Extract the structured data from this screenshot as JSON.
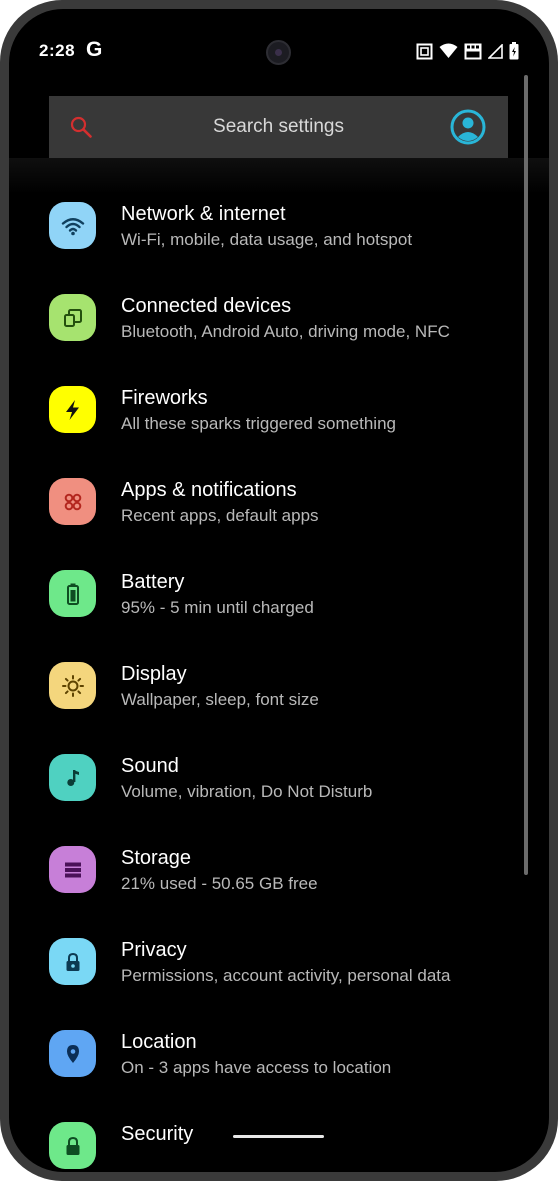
{
  "status_bar": {
    "time": "2:28",
    "g_label": "G",
    "icons": [
      "nfc-icon",
      "wifi-icon",
      "volte-icon",
      "signal-icon",
      "battery-icon"
    ]
  },
  "search": {
    "placeholder": "Search settings"
  },
  "colors": {
    "search_icon": "#d32f2f",
    "account_icon": "#29b6d8"
  },
  "items": [
    {
      "title": "Network & internet",
      "sub": "Wi-Fi, mobile, data usage, and hotspot",
      "icon": "wifi-icon",
      "color": "#90d4f7"
    },
    {
      "title": "Connected devices",
      "sub": "Bluetooth, Android Auto, driving mode, NFC",
      "icon": "devices-icon",
      "color": "#a6e36f"
    },
    {
      "title": "Fireworks",
      "sub": "All these sparks triggered something",
      "icon": "lightning-icon",
      "color": "#ffff00"
    },
    {
      "title": "Apps & notifications",
      "sub": "Recent apps, default apps",
      "icon": "apps-icon",
      "color": "#f08f80"
    },
    {
      "title": "Battery",
      "sub": "95% - 5 min until charged",
      "icon": "battery-icon",
      "color": "#6ee88a"
    },
    {
      "title": "Display",
      "sub": "Wallpaper, sleep, font size",
      "icon": "brightness-icon",
      "color": "#f4d67d"
    },
    {
      "title": "Sound",
      "sub": "Volume, vibration, Do Not Disturb",
      "icon": "music-note-icon",
      "color": "#4fd1c1"
    },
    {
      "title": "Storage",
      "sub": "21% used - 50.65 GB free",
      "icon": "storage-icon",
      "color": "#c77fd8"
    },
    {
      "title": "Privacy",
      "sub": "Permissions, account activity, personal data",
      "icon": "lock-icon",
      "color": "#7ad8f5"
    },
    {
      "title": "Location",
      "sub": "On - 3 apps have access to location",
      "icon": "location-pin-icon",
      "color": "#5fa6f3"
    },
    {
      "title": "Security",
      "sub": "",
      "icon": "security-icon",
      "color": "#6ee88a"
    }
  ]
}
